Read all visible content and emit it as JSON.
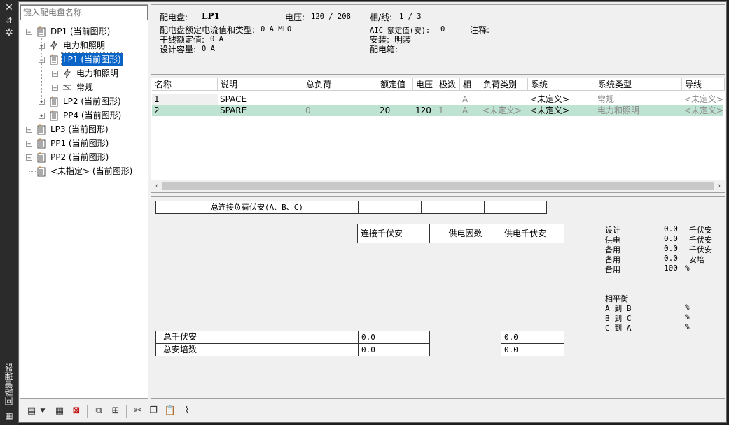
{
  "strip": {
    "close_icon": "close-icon",
    "title": "回路管理器"
  },
  "tree": {
    "search_placeholder": "键入配电盘名称",
    "nodes": [
      {
        "label": "DP1 (当前图形)"
      },
      {
        "label": "电力和照明"
      },
      {
        "label": "LP1 (当前图形)"
      },
      {
        "label": "电力和照明"
      },
      {
        "label": "常规"
      },
      {
        "label": "LP2 (当前图形)"
      },
      {
        "label": "PP4 (当前图形)"
      },
      {
        "label": "LP3 (当前图形)"
      },
      {
        "label": "PP1 (当前图形)"
      },
      {
        "label": "PP2 (当前图形)"
      },
      {
        "label": "<未指定> (当前图形)"
      }
    ]
  },
  "info": {
    "panel_label": "配电盘:",
    "panel_value": "LP1",
    "voltage_label": "电压:",
    "voltage_value": "120 / 208",
    "phase_label": "相/线:",
    "phase_value": "1 / 3",
    "rating_label": "配电盘额定电流值和类型:",
    "rating_value": "0 A MLO",
    "aic_label": "AIC 额定值(安):",
    "aic_value": "0",
    "notes_label": "注释:",
    "feeder_label": "干线额定值:",
    "feeder_value": "0 A",
    "mount_label": "安装:",
    "mount_value": "明装",
    "design_label": "设计容量:",
    "design_value": "0 A",
    "enclosure_label": "配电箱:"
  },
  "grid": {
    "headers": [
      "名称",
      "说明",
      "总负荷",
      "额定值",
      "电压",
      "极数",
      "相",
      "负荷类别",
      "系统",
      "系统类型",
      "导线"
    ],
    "rows": [
      [
        "1",
        "SPACE",
        "",
        "",
        "",
        "",
        "A",
        "",
        "<未定义>",
        "常规",
        "<未定义>"
      ],
      [
        "2",
        "SPARE",
        "0",
        "20",
        "120",
        "1",
        "A",
        "<未定义>",
        "<未定义>",
        "电力和照明",
        "<未定义>"
      ]
    ]
  },
  "summary": {
    "total_connected_label": "总连接负荷伏安(A、B、C)",
    "col_connected": "连接千伏安",
    "col_demand_factor": "供电因数",
    "col_demand": "供电千伏安",
    "total_kva_label": "总千伏安",
    "total_kva_connected": "0.0",
    "total_kva_demand": "0.0",
    "total_amps_label": "总安培数",
    "total_amps_connected": "0.0",
    "total_amps_demand": "0.0",
    "stats": [
      {
        "label": "设计",
        "value": "0.0",
        "unit": "千伏安"
      },
      {
        "label": "供电",
        "value": "0.0",
        "unit": "千伏安"
      },
      {
        "label": "备用",
        "value": "0.0",
        "unit": "千伏安"
      },
      {
        "label": "备用",
        "value": "0.0",
        "unit": "安培"
      },
      {
        "label": "备用",
        "value": "100",
        "unit": "%"
      }
    ],
    "balance_title": "相平衡",
    "balance": [
      {
        "label": "A 到 B",
        "unit": "%"
      },
      {
        "label": "B 到 C",
        "unit": "%"
      },
      {
        "label": "C 到 A",
        "unit": "%"
      }
    ]
  }
}
